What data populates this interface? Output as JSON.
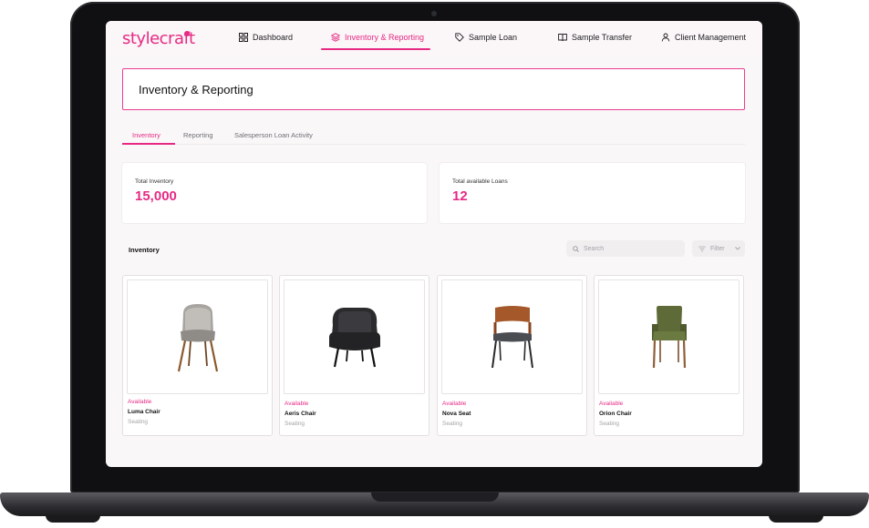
{
  "app": {
    "logo": "stylecraft",
    "brand_color": "#e62a84"
  },
  "nav": {
    "items": [
      {
        "label": "Dashboard",
        "icon": "grid-icon"
      },
      {
        "label": "Inventory & Reporting",
        "icon": "layers-icon",
        "active": true
      },
      {
        "label": "Sample Loan",
        "icon": "tag-icon"
      },
      {
        "label": "Sample Transfer",
        "icon": "book-icon"
      },
      {
        "label": "Client Management",
        "icon": "user-icon"
      }
    ]
  },
  "page": {
    "title": "Inventory & Reporting"
  },
  "tabs": [
    {
      "label": "Inventory",
      "active": true
    },
    {
      "label": "Reporting"
    },
    {
      "label": "Salesperson Loan Activity"
    }
  ],
  "stats": [
    {
      "label": "Total Inventory",
      "value": "15,000"
    },
    {
      "label": "Total available Loans",
      "value": "12"
    }
  ],
  "inventory": {
    "title": "Inventory",
    "search_placeholder": "Search",
    "filter_label": "Filter",
    "products": [
      {
        "status": "Available",
        "name": "Luma Chair",
        "category": "Seating",
        "image": "grey-upholstered-chair"
      },
      {
        "status": "Available",
        "name": "Aeris Chair",
        "category": "Seating",
        "image": "black-lounge-chair"
      },
      {
        "status": "Available",
        "name": "Nova Seat",
        "category": "Seating",
        "image": "walnut-bentwood-chair"
      },
      {
        "status": "Available",
        "name": "Orion Chair",
        "category": "Seating",
        "image": "green-dining-armchair"
      }
    ]
  }
}
